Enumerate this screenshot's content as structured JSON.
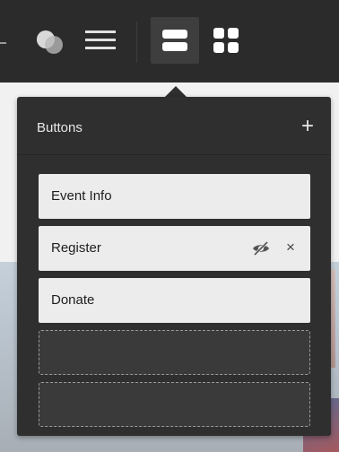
{
  "toolbar": {
    "icons": [
      "circles-icon",
      "menu-icon",
      "stack-layout-icon",
      "grid-layout-icon"
    ],
    "active": "stack-layout-icon"
  },
  "panel": {
    "title": "Buttons",
    "add_label": "+",
    "items": [
      {
        "label": "Event Info",
        "hidden": false
      },
      {
        "label": "Register",
        "hidden": true,
        "remove_label": "×"
      },
      {
        "label": "Donate",
        "hidden": false
      }
    ],
    "empty_slots": 2
  },
  "colors": {
    "toolbar_bg": "#2b2b2b",
    "panel_bg": "#2f2f2f",
    "item_bg": "#ececec",
    "active_tool_bg": "#3e3e3e"
  }
}
